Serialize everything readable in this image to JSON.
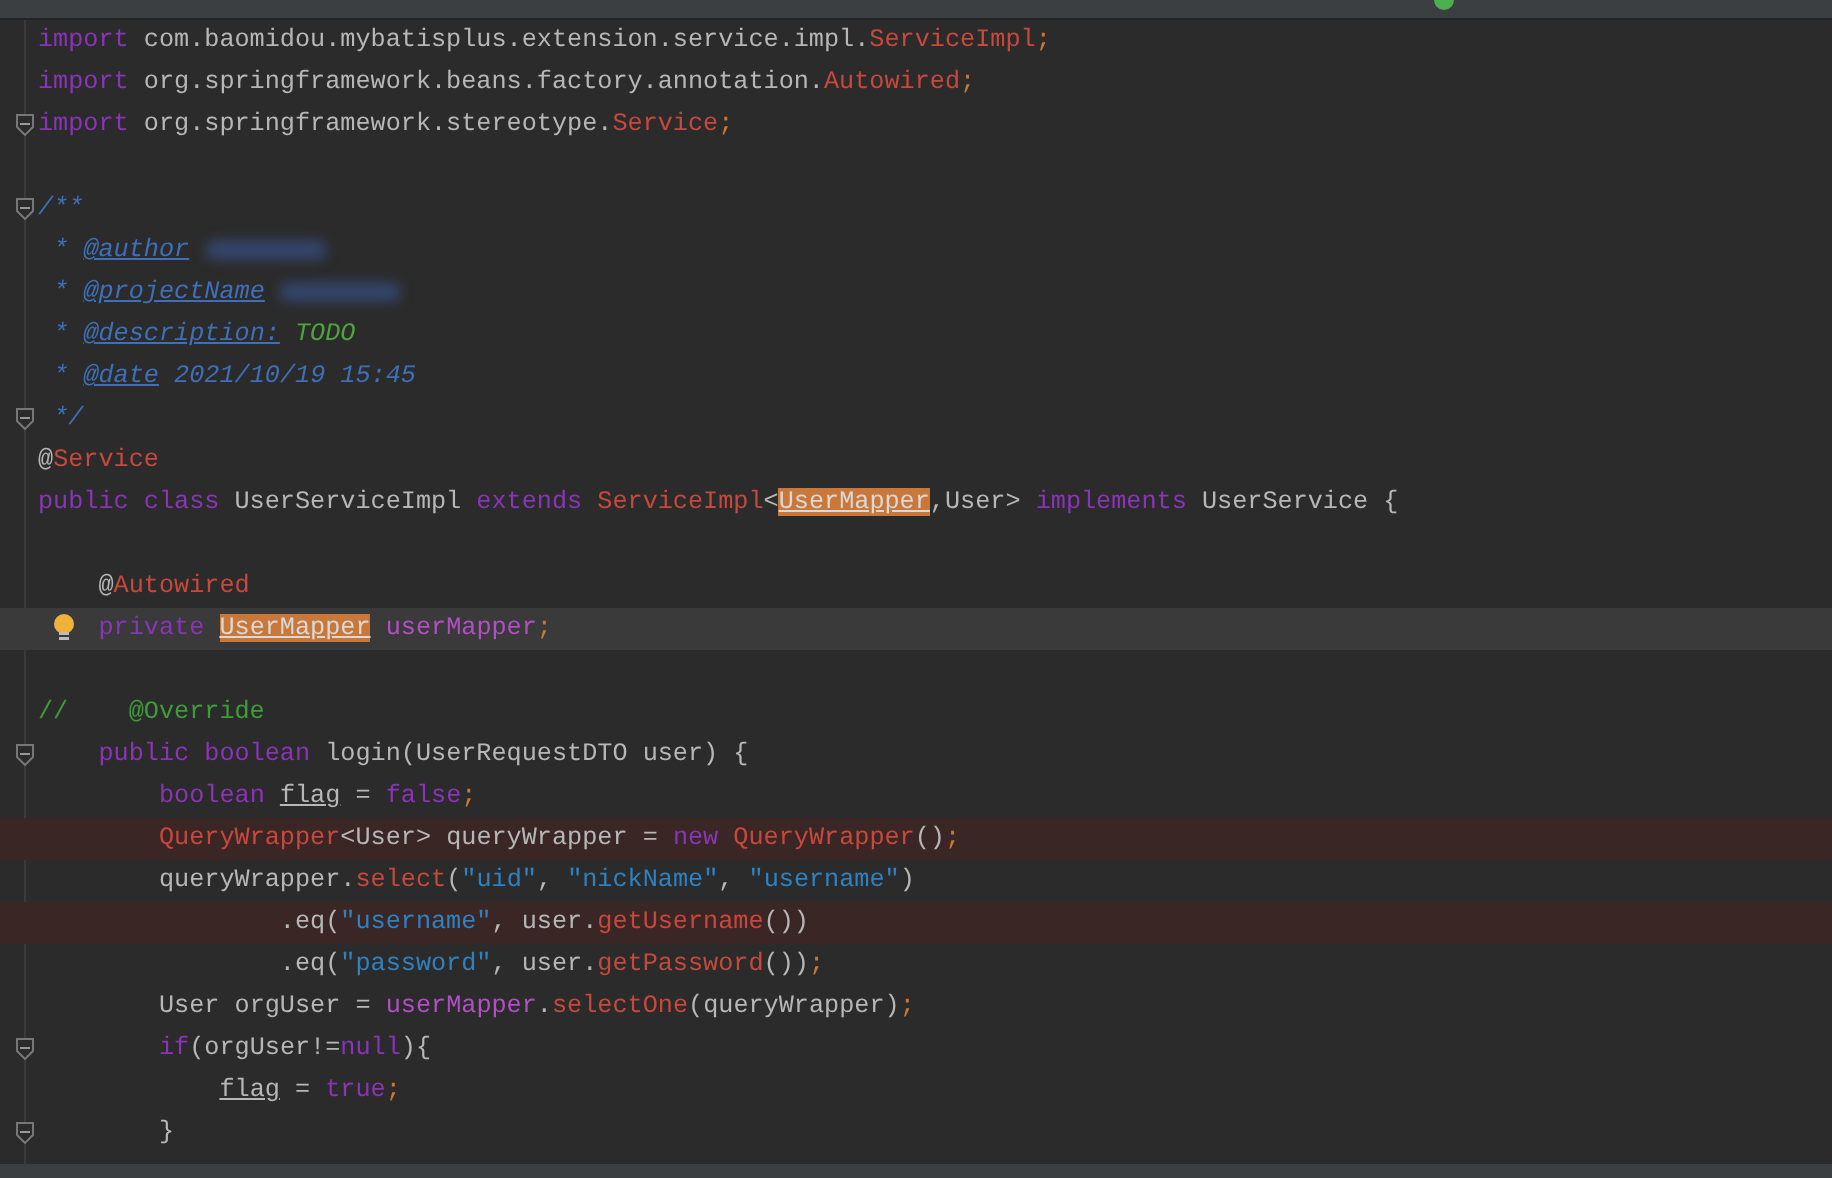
{
  "editor": {
    "lines": [
      {
        "error": false,
        "current": false,
        "fold_marker": false,
        "bulb": false,
        "tokens": [
          {
            "t": "import ",
            "kind": "kw"
          },
          {
            "t": "com.baomidou.mybatisplus.extension.service.impl.",
            "kind": "plain"
          },
          {
            "t": "ServiceImpl",
            "kind": "type"
          },
          {
            "t": ";",
            "kind": "semi"
          }
        ]
      },
      {
        "error": false,
        "current": false,
        "fold_marker": false,
        "bulb": false,
        "tokens": [
          {
            "t": "import ",
            "kind": "kw"
          },
          {
            "t": "org.springframework.beans.factory.annotation.",
            "kind": "plain"
          },
          {
            "t": "Autowired",
            "kind": "type"
          },
          {
            "t": ";",
            "kind": "semi"
          }
        ]
      },
      {
        "error": false,
        "current": false,
        "fold_marker": true,
        "bulb": false,
        "tokens": [
          {
            "t": "import ",
            "kind": "kw"
          },
          {
            "t": "org.springframework.stereotype.",
            "kind": "plain"
          },
          {
            "t": "Service",
            "kind": "type"
          },
          {
            "t": ";",
            "kind": "semi"
          }
        ]
      },
      {
        "error": false,
        "current": false,
        "fold_marker": false,
        "bulb": false
      },
      {
        "error": false,
        "current": false,
        "fold_marker": true,
        "bulb": false,
        "tokens": [
          {
            "t": "/**",
            "kind": "doc"
          }
        ]
      },
      {
        "error": false,
        "current": false,
        "fold_marker": false,
        "bulb": false,
        "tokens": [
          {
            "t": " * ",
            "kind": "doc"
          },
          {
            "t": "@author",
            "kind": "doctag"
          },
          {
            "kind": "blur"
          }
        ]
      },
      {
        "error": false,
        "current": false,
        "fold_marker": false,
        "bulb": false,
        "tokens": [
          {
            "t": " * ",
            "kind": "doc"
          },
          {
            "t": "@projectName",
            "kind": "doctag"
          },
          {
            "kind": "blur"
          }
        ]
      },
      {
        "error": false,
        "current": false,
        "fold_marker": false,
        "bulb": false,
        "tokens": [
          {
            "t": " * ",
            "kind": "doc"
          },
          {
            "t": "@description:",
            "kind": "doctag"
          },
          {
            "t": " TODO",
            "kind": "todo"
          }
        ]
      },
      {
        "error": false,
        "current": false,
        "fold_marker": false,
        "bulb": false,
        "tokens": [
          {
            "t": " * ",
            "kind": "doc"
          },
          {
            "t": "@date",
            "kind": "doctag"
          },
          {
            "t": " 2021/10/19 15:45",
            "kind": "doc"
          }
        ]
      },
      {
        "error": false,
        "current": false,
        "fold_marker": true,
        "bulb": false,
        "tokens": [
          {
            "t": " */",
            "kind": "doc"
          }
        ]
      },
      {
        "error": false,
        "current": false,
        "fold_marker": false,
        "bulb": false,
        "tokens": [
          {
            "t": "@",
            "kind": "plain"
          },
          {
            "t": "Service",
            "kind": "type"
          }
        ]
      },
      {
        "error": false,
        "current": false,
        "fold_marker": false,
        "bulb": false,
        "tokens": [
          {
            "t": "public class ",
            "kind": "kw"
          },
          {
            "t": "UserServiceImpl ",
            "kind": "plain"
          },
          {
            "t": "extends ",
            "kind": "kw"
          },
          {
            "t": "ServiceImpl",
            "kind": "type"
          },
          {
            "t": "<",
            "kind": "plain"
          },
          {
            "t": "UserMapper",
            "kind": "plain",
            "match": true
          },
          {
            "t": ",User> ",
            "kind": "plain"
          },
          {
            "t": "implements ",
            "kind": "kw"
          },
          {
            "t": "UserService {",
            "kind": "plain"
          }
        ]
      },
      {
        "error": false,
        "current": false,
        "fold_marker": false,
        "bulb": false
      },
      {
        "error": false,
        "current": false,
        "fold_marker": false,
        "bulb": false,
        "tokens": [
          {
            "t": "    @",
            "kind": "plain"
          },
          {
            "t": "Autowired",
            "kind": "type"
          }
        ]
      },
      {
        "error": false,
        "current": true,
        "fold_marker": false,
        "bulb": true,
        "tokens": [
          {
            "t": "    private ",
            "kind": "kw"
          },
          {
            "t": "UserMapper",
            "kind": "plain",
            "match": true
          },
          {
            "t": " userMapper",
            "kind": "field"
          },
          {
            "t": ";",
            "kind": "semi"
          }
        ]
      },
      {
        "error": false,
        "current": false,
        "fold_marker": false,
        "bulb": false
      },
      {
        "error": false,
        "current": false,
        "fold_marker": false,
        "bulb": false,
        "tokens": [
          {
            "t": "//    @Override",
            "kind": "comment"
          }
        ]
      },
      {
        "error": false,
        "current": false,
        "fold_marker": true,
        "bulb": false,
        "tokens": [
          {
            "t": "    public boolean ",
            "kind": "kw"
          },
          {
            "t": "login(UserRequestDTO user) {",
            "kind": "plain"
          }
        ]
      },
      {
        "error": false,
        "current": false,
        "fold_marker": false,
        "bulb": false,
        "tokens": [
          {
            "t": "        boolean ",
            "kind": "kw"
          },
          {
            "t": "flag",
            "kind": "plain",
            "underlined": true
          },
          {
            "t": " = ",
            "kind": "plain"
          },
          {
            "t": "false",
            "kind": "kw"
          },
          {
            "t": ";",
            "kind": "semi"
          }
        ]
      },
      {
        "error": true,
        "current": false,
        "fold_marker": false,
        "bulb": false,
        "tokens": [
          {
            "t": "        QueryWrapper",
            "kind": "type"
          },
          {
            "t": "<User> queryWrapper = ",
            "kind": "plain"
          },
          {
            "t": "new ",
            "kind": "kw"
          },
          {
            "t": "QueryWrapper",
            "kind": "type"
          },
          {
            "t": "()",
            "kind": "plain"
          },
          {
            "t": ";",
            "kind": "semi"
          }
        ]
      },
      {
        "error": false,
        "current": false,
        "fold_marker": false,
        "bulb": false,
        "tokens": [
          {
            "t": "        queryWrapper.",
            "kind": "plain"
          },
          {
            "t": "select",
            "kind": "type"
          },
          {
            "t": "(",
            "kind": "plain"
          },
          {
            "t": "\"uid\"",
            "kind": "str"
          },
          {
            "t": ", ",
            "kind": "plain"
          },
          {
            "t": "\"nickName\"",
            "kind": "str"
          },
          {
            "t": ", ",
            "kind": "plain"
          },
          {
            "t": "\"username\"",
            "kind": "str"
          },
          {
            "t": ")",
            "kind": "plain"
          }
        ]
      },
      {
        "error": true,
        "current": false,
        "fold_marker": false,
        "bulb": false,
        "tokens": [
          {
            "t": "                .eq(",
            "kind": "plain"
          },
          {
            "t": "\"username\"",
            "kind": "str"
          },
          {
            "t": ", user.",
            "kind": "plain"
          },
          {
            "t": "getUsername",
            "kind": "type"
          },
          {
            "t": "())",
            "kind": "plain"
          }
        ]
      },
      {
        "error": false,
        "current": false,
        "fold_marker": false,
        "bulb": false,
        "tokens": [
          {
            "t": "                .eq(",
            "kind": "plain"
          },
          {
            "t": "\"password\"",
            "kind": "str"
          },
          {
            "t": ", user.",
            "kind": "plain"
          },
          {
            "t": "getPassword",
            "kind": "type"
          },
          {
            "t": "())",
            "kind": "plain"
          },
          {
            "t": ";",
            "kind": "semi"
          }
        ]
      },
      {
        "error": false,
        "current": false,
        "fold_marker": false,
        "bulb": false,
        "tokens": [
          {
            "t": "        User orgUser = ",
            "kind": "plain"
          },
          {
            "t": "userMapper",
            "kind": "field"
          },
          {
            "t": ".",
            "kind": "plain"
          },
          {
            "t": "selectOne",
            "kind": "type"
          },
          {
            "t": "(queryWrapper)",
            "kind": "plain"
          },
          {
            "t": ";",
            "kind": "semi"
          }
        ]
      },
      {
        "error": false,
        "current": false,
        "fold_marker": true,
        "bulb": false,
        "tokens": [
          {
            "t": "        if",
            "kind": "kw"
          },
          {
            "t": "(orgUser!=",
            "kind": "plain"
          },
          {
            "t": "null",
            "kind": "kw"
          },
          {
            "t": "){",
            "kind": "plain"
          }
        ]
      },
      {
        "error": false,
        "current": false,
        "fold_marker": false,
        "bulb": false,
        "tokens": [
          {
            "t": "            flag",
            "kind": "plain",
            "underlined": true
          },
          {
            "t": " = ",
            "kind": "plain"
          },
          {
            "t": "true",
            "kind": "kw"
          },
          {
            "t": ";",
            "kind": "semi"
          }
        ]
      },
      {
        "error": false,
        "current": false,
        "fold_marker": true,
        "bulb": false,
        "tokens": [
          {
            "t": "        }",
            "kind": "plain"
          }
        ]
      }
    ]
  }
}
